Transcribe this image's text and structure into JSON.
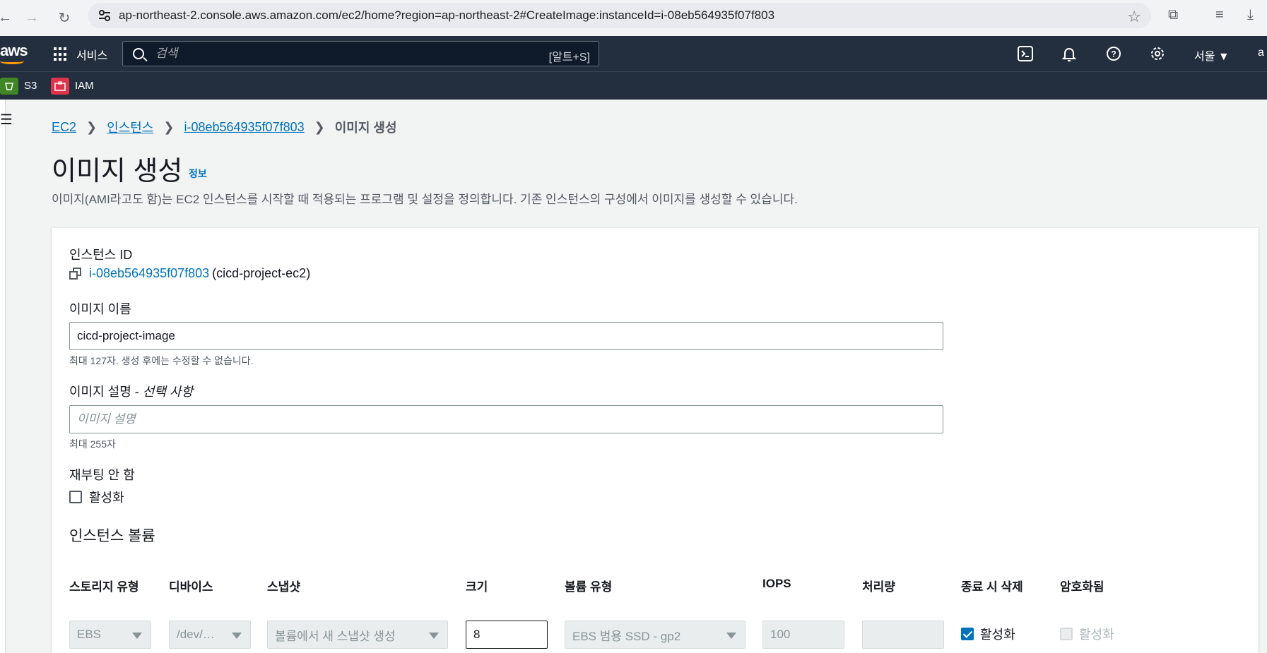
{
  "browser": {
    "url": "ap-northeast-2.console.aws.amazon.com/ec2/home?region=ap-northeast-2#CreateImage:instanceId=i-08eb564935f07f803"
  },
  "aws_nav": {
    "logo": "aws",
    "services_label": "서비스",
    "search_placeholder": "검색",
    "search_shortcut": "[알트+S]",
    "region": "서울 ▼",
    "account": "a"
  },
  "favorites": [
    {
      "label": "S3",
      "color": "#3f8624"
    },
    {
      "label": "IAM",
      "color": "#dd344c"
    }
  ],
  "breadcrumb": {
    "ec2": "EC2",
    "instances": "인스턴스",
    "instance_id": "i-08eb564935f07f803",
    "current": "이미지 생성"
  },
  "header": {
    "title": "이미지 생성",
    "info": "정보",
    "description": "이미지(AMI라고도 함)는 EC2 인스턴스를 시작할 때 적용되는 프로그램 및 설정을 정의합니다. 기존 인스턴스의 구성에서 이미지를 생성할 수 있습니다."
  },
  "form": {
    "instance_id_label": "인스턴스 ID",
    "instance_id_value": "i-08eb564935f07f803",
    "instance_name": "(cicd-project-ec2)",
    "image_name_label": "이미지 이름",
    "image_name_value": "cicd-project-image",
    "image_name_help": "최대 127자. 생성 후에는 수정할 수 없습니다.",
    "image_desc_label": "이미지 설명 - ",
    "image_desc_optional": "선택 사항",
    "image_desc_placeholder": "이미지 설명",
    "image_desc_help": "최대 255자",
    "no_reboot_label": "재부팅 안 함",
    "no_reboot_checkbox": "활성화",
    "volumes_title": "인스턴스 볼륨"
  },
  "volume_table": {
    "headers": [
      "스토리지 유형",
      "디바이스",
      "스냅샷",
      "크기",
      "볼륨 유형",
      "IOPS",
      "처리량",
      "종료 시 삭제",
      "암호화됨"
    ],
    "row": {
      "storage_type": "EBS",
      "device": "/dev/…",
      "snapshot": "볼륨에서 새 스냅샷 생성",
      "size": "8",
      "volume_type": "EBS 범용 SSD - gp2",
      "iops": "100",
      "throughput": "",
      "delete_on_termination": "활성화",
      "encrypted": "활성화"
    }
  }
}
